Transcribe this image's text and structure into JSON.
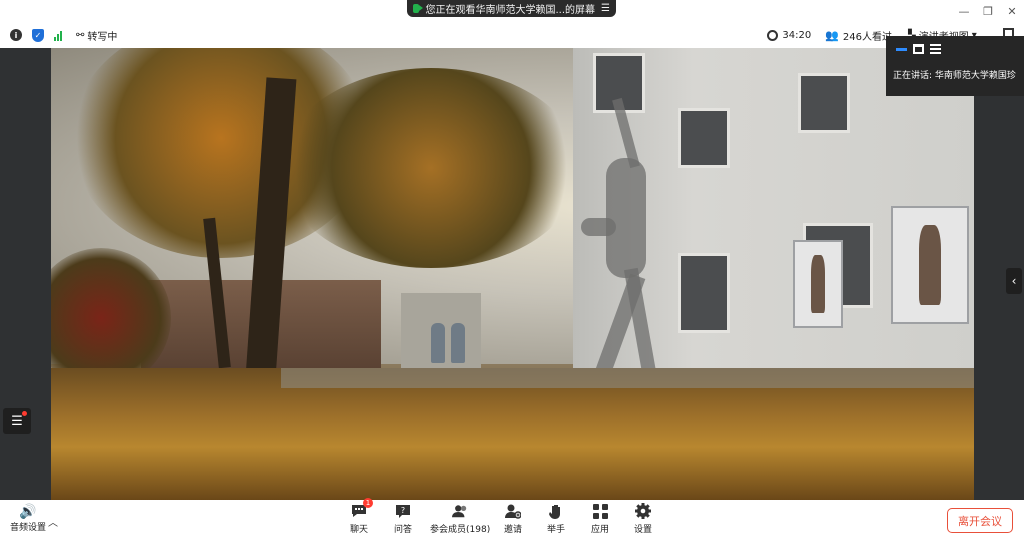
{
  "share_banner": {
    "text": "您正在观看华南师范大学赖国...的屏幕",
    "menu_icon": "menu-icon"
  },
  "window_controls": {
    "minimize": "—",
    "restore": "❐",
    "close": "✕"
  },
  "toolbar": {
    "transcribing": "转写中",
    "timer": "34:20",
    "viewers": "246人看过",
    "view_mode": "演讲者视图"
  },
  "speaker_panel": {
    "talking_label": "正在讲话: 华南师范大学赖国珍"
  },
  "bottom": {
    "audio_settings": "音频设置",
    "buttons": [
      {
        "label": "聊天",
        "icon": "chat-icon",
        "badge": "1"
      },
      {
        "label": "问答",
        "icon": "qa-icon"
      },
      {
        "label": "参会成员(198)",
        "icon": "participants-icon"
      },
      {
        "label": "邀请",
        "icon": "invite-icon"
      },
      {
        "label": "举手",
        "icon": "raise-hand-icon"
      },
      {
        "label": "应用",
        "icon": "apps-icon"
      },
      {
        "label": "设置",
        "icon": "settings-icon"
      }
    ],
    "leave": "离开会议"
  },
  "colors": {
    "accent": "#2e8cff",
    "leave": "#e8503a",
    "signal": "#22b14c"
  }
}
